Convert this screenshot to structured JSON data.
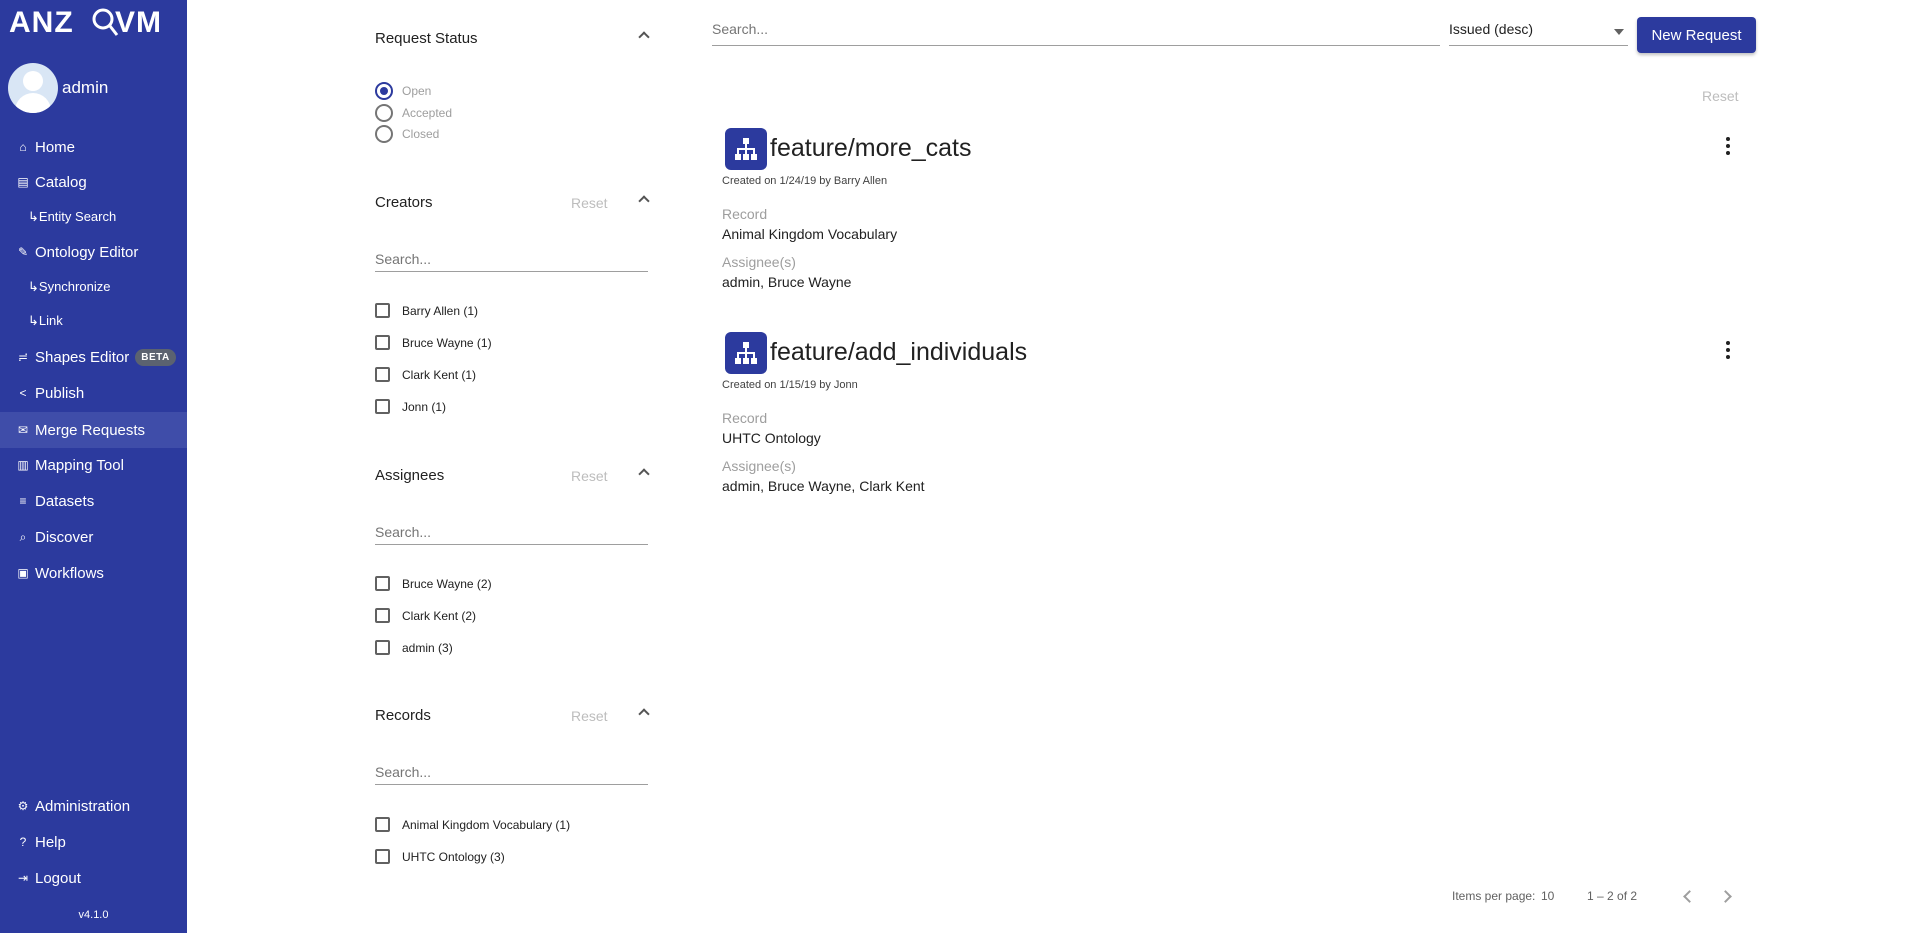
{
  "app": {
    "logo": "ANZO VM",
    "user": "admin",
    "version": "v4.1.0"
  },
  "sidebar": {
    "items": [
      {
        "label": "Home",
        "icon": "home-icon"
      },
      {
        "label": "Catalog",
        "icon": "book-icon"
      },
      {
        "label": "↳Entity Search",
        "icon": ""
      },
      {
        "label": "Ontology Editor",
        "icon": "edit-icon"
      },
      {
        "label": "↳Synchronize",
        "icon": ""
      },
      {
        "label": "↳Link",
        "icon": ""
      },
      {
        "label": "Shapes Editor",
        "icon": "shapes-icon",
        "badge": "BETA"
      },
      {
        "label": "Publish",
        "icon": "share-icon"
      },
      {
        "label": "Merge Requests",
        "icon": "envelope-icon",
        "active": true
      },
      {
        "label": "Mapping Tool",
        "icon": "map-icon"
      },
      {
        "label": "Datasets",
        "icon": "database-icon"
      },
      {
        "label": "Discover",
        "icon": "search-icon"
      },
      {
        "label": "Workflows",
        "icon": "workflow-icon"
      }
    ],
    "bottom": [
      {
        "label": "Administration",
        "icon": "gear-icon"
      },
      {
        "label": "Help",
        "icon": "question-icon"
      },
      {
        "label": "Logout",
        "icon": "logout-icon"
      }
    ]
  },
  "filters": {
    "status": {
      "title": "Request Status",
      "options": [
        "Open",
        "Accepted",
        "Closed"
      ],
      "selected": "Open"
    },
    "creators": {
      "title": "Creators",
      "reset": "Reset",
      "search_placeholder": "Search...",
      "items": [
        "Barry Allen (1)",
        "Bruce Wayne (1)",
        "Clark Kent (1)",
        "Jonn (1)"
      ]
    },
    "assignees": {
      "title": "Assignees",
      "reset": "Reset",
      "search_placeholder": "Search...",
      "items": [
        "Bruce Wayne (2)",
        "Clark Kent (2)",
        "admin (3)"
      ]
    },
    "records": {
      "title": "Records",
      "reset": "Reset",
      "search_placeholder": "Search...",
      "items": [
        "Animal Kingdom Vocabulary (1)",
        "UHTC Ontology (3)"
      ]
    }
  },
  "main": {
    "search_placeholder": "Search...",
    "sort_value": "Issued (desc)",
    "new_request_label": "New Request",
    "reset_label": "Reset",
    "requests": [
      {
        "title": "feature/more_cats",
        "created": "Created on 1/24/19 by Barry Allen",
        "record_label": "Record",
        "record": "Animal Kingdom Vocabulary",
        "assignees_label": "Assignee(s)",
        "assignees": "admin, Bruce Wayne"
      },
      {
        "title": "feature/add_individuals",
        "created": "Created on 1/15/19 by Jonn",
        "record_label": "Record",
        "record": "UHTC Ontology",
        "assignees_label": "Assignee(s)",
        "assignees": "admin, Bruce Wayne, Clark Kent"
      }
    ],
    "paginator": {
      "items_per_page": "Items per page:",
      "page_size": "10",
      "range": "1 – 2 of 2"
    }
  }
}
